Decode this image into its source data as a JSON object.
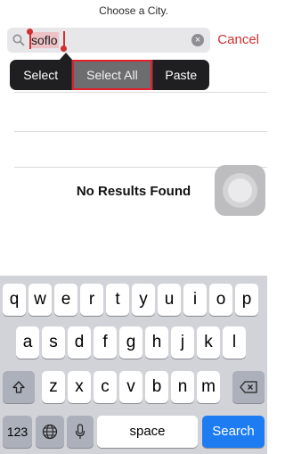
{
  "header": {
    "title": "Choose a City."
  },
  "search": {
    "query": "soflo",
    "cancel_label": "Cancel"
  },
  "edit_menu": {
    "select": "Select",
    "select_all": "Select All",
    "paste": "Paste"
  },
  "results": {
    "empty_text": "No Results Found"
  },
  "keyboard": {
    "row1": [
      "q",
      "w",
      "e",
      "r",
      "t",
      "y",
      "u",
      "i",
      "o",
      "p"
    ],
    "row2": [
      "a",
      "s",
      "d",
      "f",
      "g",
      "h",
      "j",
      "k",
      "l"
    ],
    "row3": [
      "z",
      "x",
      "c",
      "v",
      "b",
      "n",
      "m"
    ],
    "numbers_key": "123",
    "space_label": "space",
    "search_label": "Search"
  },
  "colors": {
    "accent": "#d0302f",
    "keyboard_bg": "#d1d3d9",
    "search_key": "#1e7cf2"
  }
}
